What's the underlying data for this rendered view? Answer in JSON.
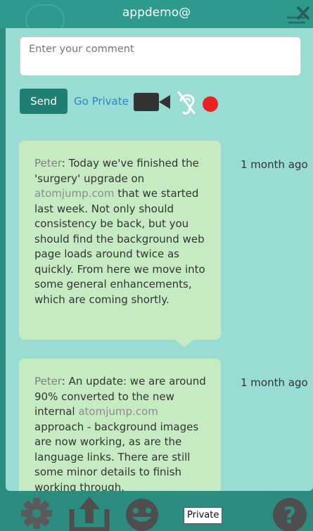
{
  "header": {
    "title": "appdemo@"
  },
  "composer": {
    "placeholder": "Enter your comment",
    "send_label": "Send",
    "private_label": "Go Private",
    "camera_icon": "video-camera-icon",
    "ear_icon": "deaf-ear-icon",
    "record_color": "#ee2222"
  },
  "messages": [
    {
      "author": "Peter",
      "time": "1 month ago",
      "text_before": ": Today we've finished the 'surgery' upgrade on ",
      "link": "atomjump.com",
      "text_after": " that we started last week. Not only should consistency be back, but you should find the background web page loads around twice as quickly. From here we move into some general enhancements, which are coming shortly."
    },
    {
      "author": "Peter",
      "time": "1 month ago",
      "text_before": ": An update: we are around 90% converted to the new internal ",
      "link": "atomjump.com",
      "text_after": " approach - background images are now working, as are the language links. There are still some minor details to finish working through."
    }
  ],
  "footer": {
    "private_tag": "Private",
    "icons": [
      "gear-icon",
      "upload-icon",
      "emoji-icon",
      "help-icon"
    ]
  },
  "colors": {
    "panel": "#99dcd4",
    "bubble": "#c6ebc2",
    "send": "#1e7f72",
    "frame": "#2d8c80",
    "link": "#2a86c5"
  }
}
